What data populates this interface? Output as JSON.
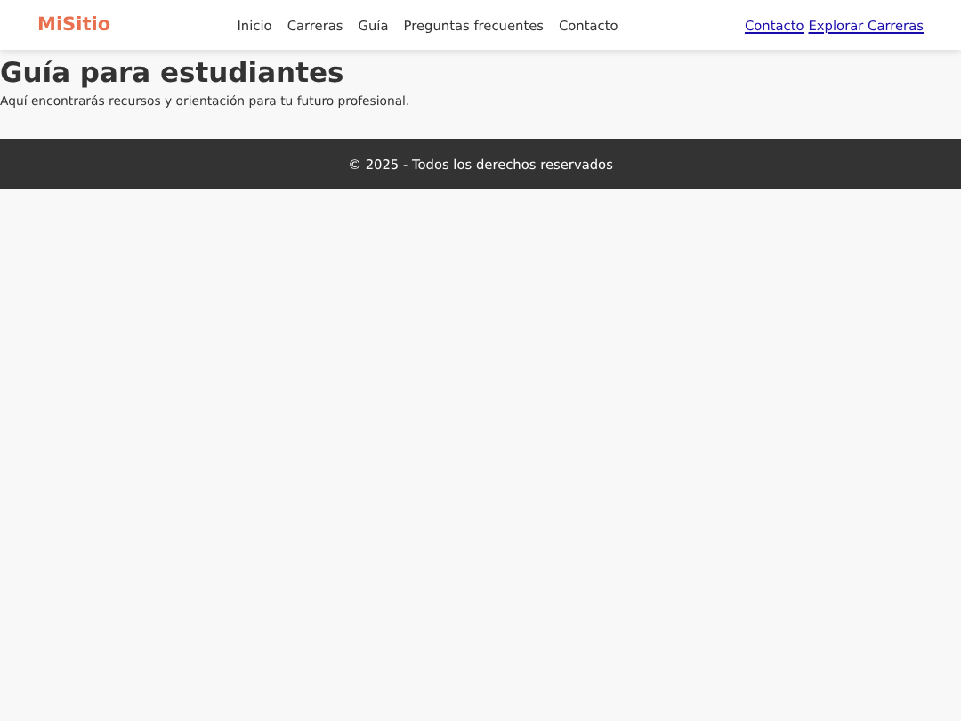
{
  "header": {
    "logo": "MiSitio",
    "nav": [
      "Inicio",
      "Carreras",
      "Guía",
      "Preguntas frecuentes",
      "Contacto"
    ],
    "actions": [
      "Contacto",
      "Explorar Carreras"
    ]
  },
  "main": {
    "title": "Guía para estudiantes",
    "text": "Aquí encontrarás recursos y orientación para tu futuro profesional."
  },
  "footer": {
    "text": "© 2025 - Todos los derechos reservados"
  }
}
